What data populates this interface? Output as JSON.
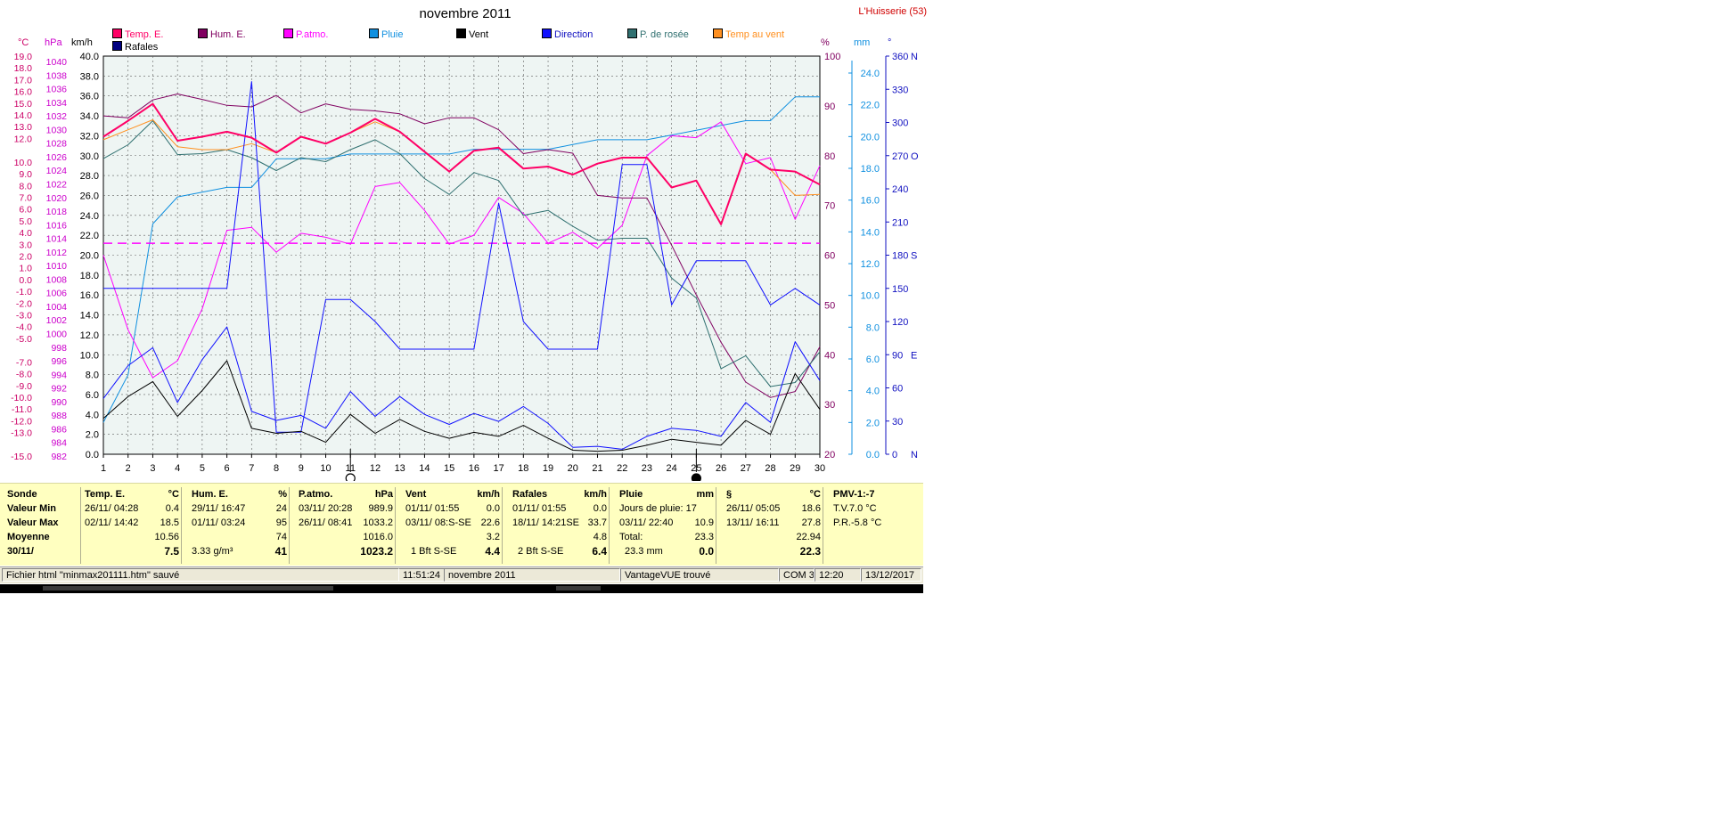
{
  "title": "novembre 2011",
  "station": "L'Huisserie (53)",
  "colors": {
    "temp": "#ff0066",
    "hum": "#800060",
    "patmo": "#ff00ff",
    "pluie": "#1090e0",
    "vent": "#000000",
    "direction": "#1010ff",
    "rosee": "#307070",
    "tempvent": "#ff9020",
    "rafales": "#000080",
    "plot_bg": "#eef5f3",
    "left_temp_axis": "#cc0066",
    "left_hpa_axis": "#cc00cc",
    "right_pct_axis": "#800060",
    "right_mm_axis": "#1090e0",
    "right_dir_axis": "#1010c0",
    "panel_bg": "#ffffc0"
  },
  "legend": [
    {
      "key": "temp",
      "label": "Temp. E."
    },
    {
      "key": "hum",
      "label": "Hum. E."
    },
    {
      "key": "patmo",
      "label": "P.atmo."
    },
    {
      "key": "pluie",
      "label": "Pluie"
    },
    {
      "key": "vent",
      "label": "Vent"
    },
    {
      "key": "direction",
      "label": "Direction"
    },
    {
      "key": "rosee",
      "label": "P. de rosée"
    },
    {
      "key": "tempvent",
      "label": "Temp au vent"
    },
    {
      "key": "rafales",
      "label": "Rafales"
    }
  ],
  "chart_data": {
    "type": "line",
    "title": "novembre 2011",
    "x": [
      1,
      2,
      3,
      4,
      5,
      6,
      7,
      8,
      9,
      10,
      11,
      12,
      13,
      14,
      15,
      16,
      17,
      18,
      19,
      20,
      21,
      22,
      23,
      24,
      25,
      26,
      27,
      28,
      29,
      30
    ],
    "grid": true,
    "axes": {
      "kmh": {
        "unit": "km/h",
        "min": 0,
        "max": 40,
        "ticks": [
          "0.0",
          "2.0",
          "4.0",
          "6.0",
          "8.0",
          "10.0",
          "12.0",
          "14.0",
          "16.0",
          "18.0",
          "20.0",
          "22.0",
          "24.0",
          "26.0",
          "28.0",
          "30.0",
          "32.0",
          "34.0",
          "36.0",
          "38.0",
          "40.0"
        ]
      },
      "temp": {
        "unit": "°C",
        "ticks": [
          "19.0",
          "18.0",
          "17.0",
          "16.0",
          "15.0",
          "14.0",
          "13.0",
          "12.0",
          "10.0",
          "9.0",
          "8.0",
          "7.0",
          "6.0",
          "5.0",
          "4.0",
          "3.0",
          "2.0",
          "1.0",
          "0.0",
          "-1.0",
          "-2.0",
          "-3.0",
          "-4.0",
          "-5.0",
          "-7.0",
          "-8.0",
          "-9.0",
          "-10.0",
          "-11.0",
          "-12.0",
          "-13.0",
          "-15.0"
        ]
      },
      "hpa": {
        "unit": "hPa",
        "min": 982,
        "max": 1040,
        "ticks": [
          "1040",
          "1038",
          "1036",
          "1034",
          "1032",
          "1030",
          "1028",
          "1026",
          "1024",
          "1022",
          "1020",
          "1018",
          "1016",
          "1014",
          "1012",
          "1010",
          "1008",
          "1006",
          "1004",
          "1002",
          "1000",
          "998",
          "996",
          "994",
          "992",
          "990",
          "988",
          "986",
          "984",
          "982"
        ]
      },
      "pct": {
        "unit": "%",
        "min": 20,
        "max": 100,
        "ticks": [
          "20",
          "30",
          "40",
          "50",
          "60",
          "70",
          "80",
          "90",
          "100"
        ]
      },
      "mm": {
        "unit": "mm",
        "min": 0,
        "max": 24,
        "ticks": [
          "0.0",
          "2.0",
          "4.0",
          "6.0",
          "8.0",
          "10.0",
          "12.0",
          "14.0",
          "16.0",
          "18.0",
          "20.0",
          "22.0",
          "24.0"
        ]
      },
      "dir": {
        "unit": "°",
        "min": 0,
        "max": 360,
        "ticks": [
          "0",
          "30",
          "60",
          "90",
          "120",
          "150",
          "180",
          "210",
          "240",
          "270",
          "300",
          "330",
          "360"
        ],
        "cardinals": {
          "0": "N",
          "90": "E",
          "180": "S",
          "270": "O",
          "360": "N"
        }
      }
    },
    "series": [
      {
        "name": "Temp. E.",
        "key": "temp",
        "axis": "kmh",
        "width": 2,
        "values": [
          31.9,
          33.5,
          35.2,
          31.5,
          31.9,
          32.4,
          31.8,
          30.3,
          31.9,
          31.2,
          32.3,
          33.7,
          32.4,
          30.4,
          28.4,
          30.5,
          30.8,
          28.7,
          28.9,
          28.1,
          29.2,
          29.8,
          29.8,
          26.8,
          27.5,
          23.1,
          30.2,
          28.6,
          28.4,
          27.1
        ]
      },
      {
        "name": "Hum. E.",
        "key": "hum",
        "axis": "pct",
        "width": 1,
        "values": [
          88,
          87.6,
          91.2,
          92.4,
          91.3,
          90.1,
          89.8,
          92.1,
          88.6,
          90.4,
          89.3,
          89,
          88.4,
          86.4,
          87.6,
          87.6,
          85.2,
          80.4,
          81.2,
          80.5,
          72,
          71.5,
          71.5,
          62,
          52,
          42.5,
          34.5,
          31.4,
          32.6,
          41.6
        ]
      },
      {
        "name": "P.atmo.",
        "key": "patmo",
        "axis": "kmh",
        "width": 1,
        "values": [
          20,
          12.5,
          7.7,
          9.4,
          14.6,
          22.5,
          22.8,
          20.3,
          22.2,
          21.8,
          21.1,
          26.9,
          27.3,
          24.5,
          21.1,
          22,
          25.8,
          24.2,
          21.2,
          22.3,
          20.7,
          23,
          30,
          32,
          31.8,
          33.4,
          29.2,
          29.8,
          23.6,
          29
        ]
      },
      {
        "name": "P.atmo. moyenne",
        "key": "patmo",
        "axis": "kmh",
        "dashed": true,
        "width": 1,
        "values": [
          21.2,
          21.2,
          21.2,
          21.2,
          21.2,
          21.2,
          21.2,
          21.2,
          21.2,
          21.2,
          21.2,
          21.2,
          21.2,
          21.2,
          21.2,
          21.2,
          21.2,
          21.2,
          21.2,
          21.2,
          21.2,
          21.2,
          21.2,
          21.2,
          21.2,
          21.2,
          21.2,
          21.2,
          21.2,
          21.2
        ]
      },
      {
        "name": "Pluie",
        "key": "pluie",
        "axis": "mm",
        "width": 1,
        "values": [
          2,
          5,
          14.5,
          16.2,
          16.5,
          16.8,
          16.8,
          18.6,
          18.6,
          18.6,
          18.9,
          18.9,
          18.9,
          18.9,
          18.9,
          19.2,
          19.2,
          19.2,
          19.2,
          19.5,
          19.8,
          19.8,
          19.8,
          20.1,
          20.4,
          20.7,
          21,
          21,
          22.5,
          22.5
        ]
      },
      {
        "name": "Vent",
        "key": "vent",
        "axis": "kmh",
        "width": 1,
        "values": [
          3.6,
          5.8,
          7.3,
          3.8,
          6.4,
          9.4,
          2.6,
          2.1,
          2.3,
          1.2,
          4,
          2.1,
          3.5,
          2.3,
          1.6,
          2.2,
          1.8,
          2.9,
          1.6,
          0.4,
          0.3,
          0.4,
          0.9,
          1.5,
          1.2,
          0.9,
          3.4,
          2,
          8.1,
          4.5
        ]
      },
      {
        "name": "Rafales",
        "key": "rafales",
        "axis": "kmh",
        "width": 1,
        "values": [
          5.6,
          8.9,
          10.7,
          5.2,
          9.5,
          12.8,
          4.3,
          3.4,
          3.9,
          2.6,
          6.3,
          3.8,
          5.8,
          4,
          3,
          4.1,
          3.3,
          4.8,
          3.1,
          0.7,
          0.8,
          0.5,
          1.8,
          2.6,
          2.4,
          1.8,
          5.2,
          3.2,
          11.3,
          7.4
        ]
      },
      {
        "name": "Direction",
        "key": "direction",
        "axis": "dir",
        "width": 1,
        "values": [
          150,
          150,
          150,
          150,
          150,
          150,
          337,
          20,
          20,
          140,
          140,
          120,
          95,
          95,
          95,
          95,
          227,
          120,
          95,
          95,
          95,
          262,
          262,
          135,
          175,
          175,
          175,
          135,
          150,
          135
        ]
      },
      {
        "name": "P. de rosée",
        "key": "rosee",
        "axis": "kmh",
        "width": 1,
        "values": [
          29.7,
          31.1,
          33.5,
          30.1,
          30.2,
          30.6,
          29.8,
          28.5,
          29.8,
          29.4,
          30.6,
          31.6,
          30.2,
          27.7,
          26.1,
          28.3,
          27.5,
          24,
          24.5,
          22.9,
          21.5,
          21.7,
          21.7,
          17.7,
          15.7,
          8.6,
          9.9,
          6.8,
          7.2,
          10.3
        ]
      },
      {
        "name": "Temp au vent",
        "key": "tempvent",
        "axis": "kmh",
        "width": 1,
        "values": [
          31.6,
          32.6,
          33.6,
          30.9,
          30.6,
          30.6,
          31.2,
          30.3,
          31.9,
          31.2,
          32.3,
          33.4,
          32.4,
          30.4,
          28.4,
          30.5,
          30.8,
          28.7,
          28.9,
          28.1,
          29.2,
          29.8,
          29.8,
          26.8,
          27.5,
          23.1,
          30.2,
          28.6,
          26,
          26.1
        ]
      }
    ],
    "markers": [
      {
        "x": 11,
        "symbol": "new-moon-outline"
      },
      {
        "x": 25,
        "symbol": "full-moon-filled"
      }
    ]
  },
  "stats": {
    "sonde": {
      "title": "Sonde",
      "rows": [
        "Valeur Min",
        "Valeur Max",
        "Moyenne",
        "30/11/"
      ]
    },
    "temp": {
      "title": "Temp. E.",
      "unit": "°C",
      "min_date": "26/11/  04:28",
      "min": "0.4",
      "max_date": "02/11/  14:42",
      "max": "18.5",
      "moyenne": "10.56",
      "current": "7.5"
    },
    "hum": {
      "title": "Hum. E.",
      "unit": "%",
      "min_date": "29/11/  16:47",
      "min": "24",
      "max_date": "01/11/  03:24",
      "max": "95",
      "moyenne": "74",
      "extra": "3.33 g/m³",
      "current": "41"
    },
    "patmo": {
      "title": "P.atmo.",
      "unit": "hPa",
      "min_date": "03/11/  20:28",
      "min": "989.9",
      "max_date": "26/11/  08:41",
      "max": "1033.2",
      "moyenne": "1016.0",
      "current": "1023.2"
    },
    "vent": {
      "title": "Vent",
      "unit": "km/h",
      "min_date": "01/11/  01:55",
      "min": "0.0",
      "max_date": "03/11/  08:S-SE",
      "max": "22.6",
      "moyenne": "3.2",
      "extra": "1 Bft S-SE",
      "current": "4.4"
    },
    "rafales": {
      "title": "Rafales",
      "unit": "km/h",
      "min_date": "01/11/  01:55",
      "min": "0.0",
      "max_date": "18/11/  14:21SE",
      "max": "33.7",
      "moyenne": "4.8",
      "extra": "2 Bft S-SE",
      "current": "6.4"
    },
    "pluie": {
      "title": "Pluie",
      "unit": "mm",
      "l1": "Jours de pluie: 17",
      "min_date": "03/11/  22:40",
      "max": "10.9",
      "l3": "Total:",
      "total": "23.3",
      "l4": "23.3 mm",
      "current": "0.0"
    },
    "section": {
      "title": "§",
      "unit": "°C",
      "min_date": "26/11/  05:05",
      "min": "18.6",
      "max_date": "13/11/  16:11",
      "max": "27.8",
      "moyenne": "22.94",
      "current": "22.3"
    },
    "pmv": {
      "title": "PMV-1:-7",
      "l1": "T.V.7.0 °C",
      "l2": "P.R.-5.8 °C"
    }
  },
  "status": {
    "file": "Fichier html  \"minmax201111.htm\"  sauvé",
    "time": "11:51:24",
    "month": "novembre 2011",
    "device": "VantageVUE trouvé",
    "port": "COM 3",
    "clock": "12:20",
    "date": "13/12/2017"
  }
}
